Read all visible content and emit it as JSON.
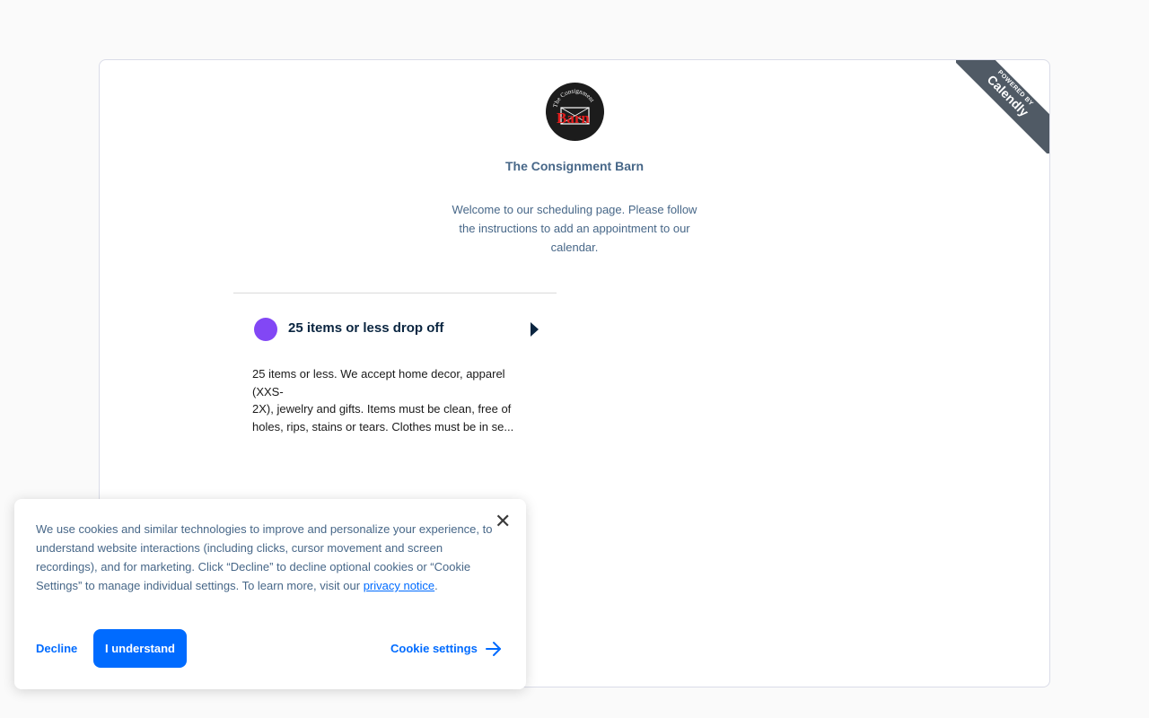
{
  "ribbon": {
    "powered_by": "POWERED BY",
    "brand": "Calendly"
  },
  "logo": {
    "arc_text": "The Consignment",
    "barn_text": "Barn"
  },
  "org": {
    "name": "The Consignment Barn",
    "welcome": "Welcome to our scheduling page. Please follow the instructions to add an appointment to our calendar."
  },
  "event": {
    "title": "25 items or less drop off",
    "dot_color": "#8247f5",
    "description": "25 items or less.   We accept home decor, apparel (XXS-\n2X), jewelry and gifts.  Items must be clean, free of holes, rips, stains or tears.   Clothes must be in se..."
  },
  "cookie_banner": {
    "text": "We use cookies and similar technologies to improve and personalize your experience, to understand website interactions (including clicks, cursor movement and screen recordings), and for marketing. Click “Decline” to decline optional cookies or “Cookie Settings” to manage individual settings. To learn more, visit our",
    "privacy_link": "privacy notice",
    "period": ".",
    "decline_label": "Decline",
    "accept_label": "I understand",
    "settings_label": "Cookie settings",
    "close_glyph": "✕"
  },
  "colors": {
    "accent": "#006bff",
    "text_muted": "#476788",
    "ribbon": "#505a65"
  }
}
